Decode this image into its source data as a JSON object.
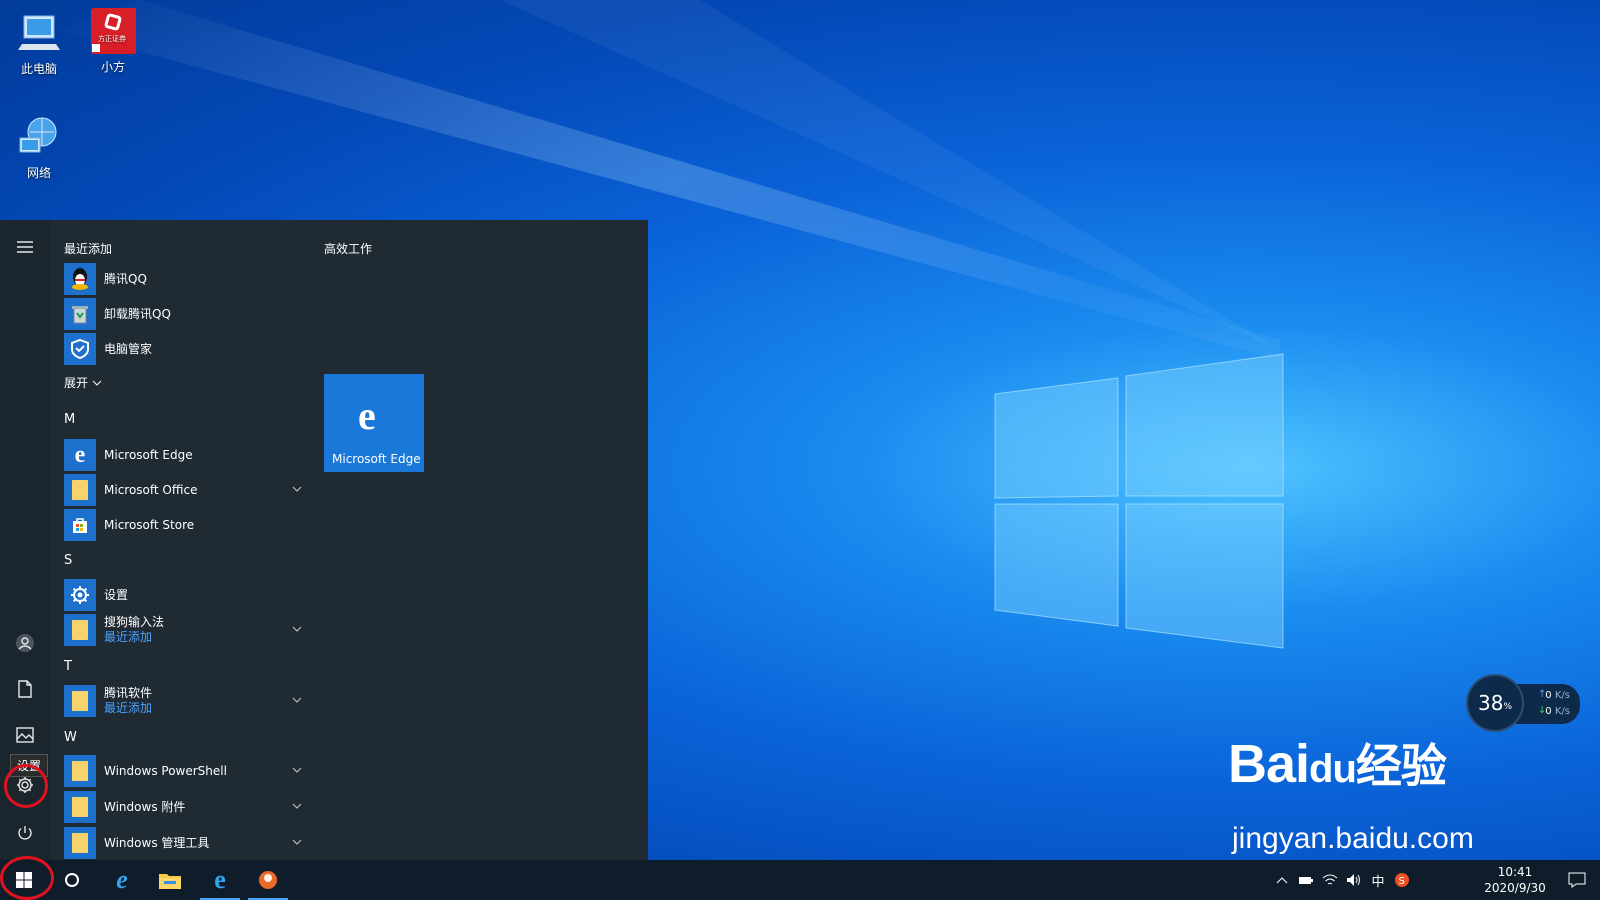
{
  "desktop": {
    "icons": [
      {
        "label": "此电脑",
        "icon": "computer-icon"
      },
      {
        "label": "小方",
        "icon": "app-shortcut-icon",
        "badge": "方正证券"
      },
      {
        "label": "网络",
        "icon": "network-icon"
      }
    ]
  },
  "start_menu": {
    "recent_header": "最近添加",
    "recent_apps": [
      {
        "name": "腾讯QQ",
        "icon": "qq-icon"
      },
      {
        "name": "卸载腾讯QQ",
        "icon": "recycle-icon"
      },
      {
        "name": "电脑管家",
        "icon": "shield-icon"
      }
    ],
    "expand_label": "展开",
    "groups": [
      {
        "letter": "M",
        "apps": [
          {
            "name": "Microsoft Edge",
            "icon": "edge-icon",
            "expandable": false
          },
          {
            "name": "Microsoft Office",
            "icon": "folder-icon",
            "expandable": true
          },
          {
            "name": "Microsoft Store",
            "icon": "store-icon",
            "expandable": false
          }
        ]
      },
      {
        "letter": "S",
        "apps": [
          {
            "name": "设置",
            "icon": "gear-icon",
            "expandable": false
          },
          {
            "name": "搜狗输入法",
            "sub": "最近添加",
            "icon": "folder-icon",
            "expandable": true
          }
        ]
      },
      {
        "letter": "T",
        "apps": [
          {
            "name": "腾讯软件",
            "sub": "最近添加",
            "icon": "folder-icon",
            "expandable": true
          }
        ]
      },
      {
        "letter": "W",
        "apps": [
          {
            "name": "Windows PowerShell",
            "icon": "folder-icon",
            "expandable": true
          },
          {
            "name": "Windows 附件",
            "icon": "folder-icon",
            "expandable": true
          },
          {
            "name": "Windows 管理工具",
            "icon": "folder-icon",
            "expandable": true
          }
        ]
      }
    ],
    "tiles_header": "高效工作",
    "tile": {
      "name": "Microsoft Edge",
      "glyph": "e"
    },
    "settings_tooltip": "设置"
  },
  "net_widget": {
    "percent": "38",
    "percent_unit": "%",
    "up": "0",
    "down": "0",
    "unit": "K/s"
  },
  "watermark": {
    "main": "Bai",
    "paw": "du",
    "cn": "经验",
    "url": "jingyan.baidu.com"
  },
  "taskbar": {
    "ime": "中",
    "time": "10:41",
    "date": "2020/9/30"
  },
  "colors": {
    "accent": "#1e70cd",
    "highlight_ring": "#e0121e"
  }
}
